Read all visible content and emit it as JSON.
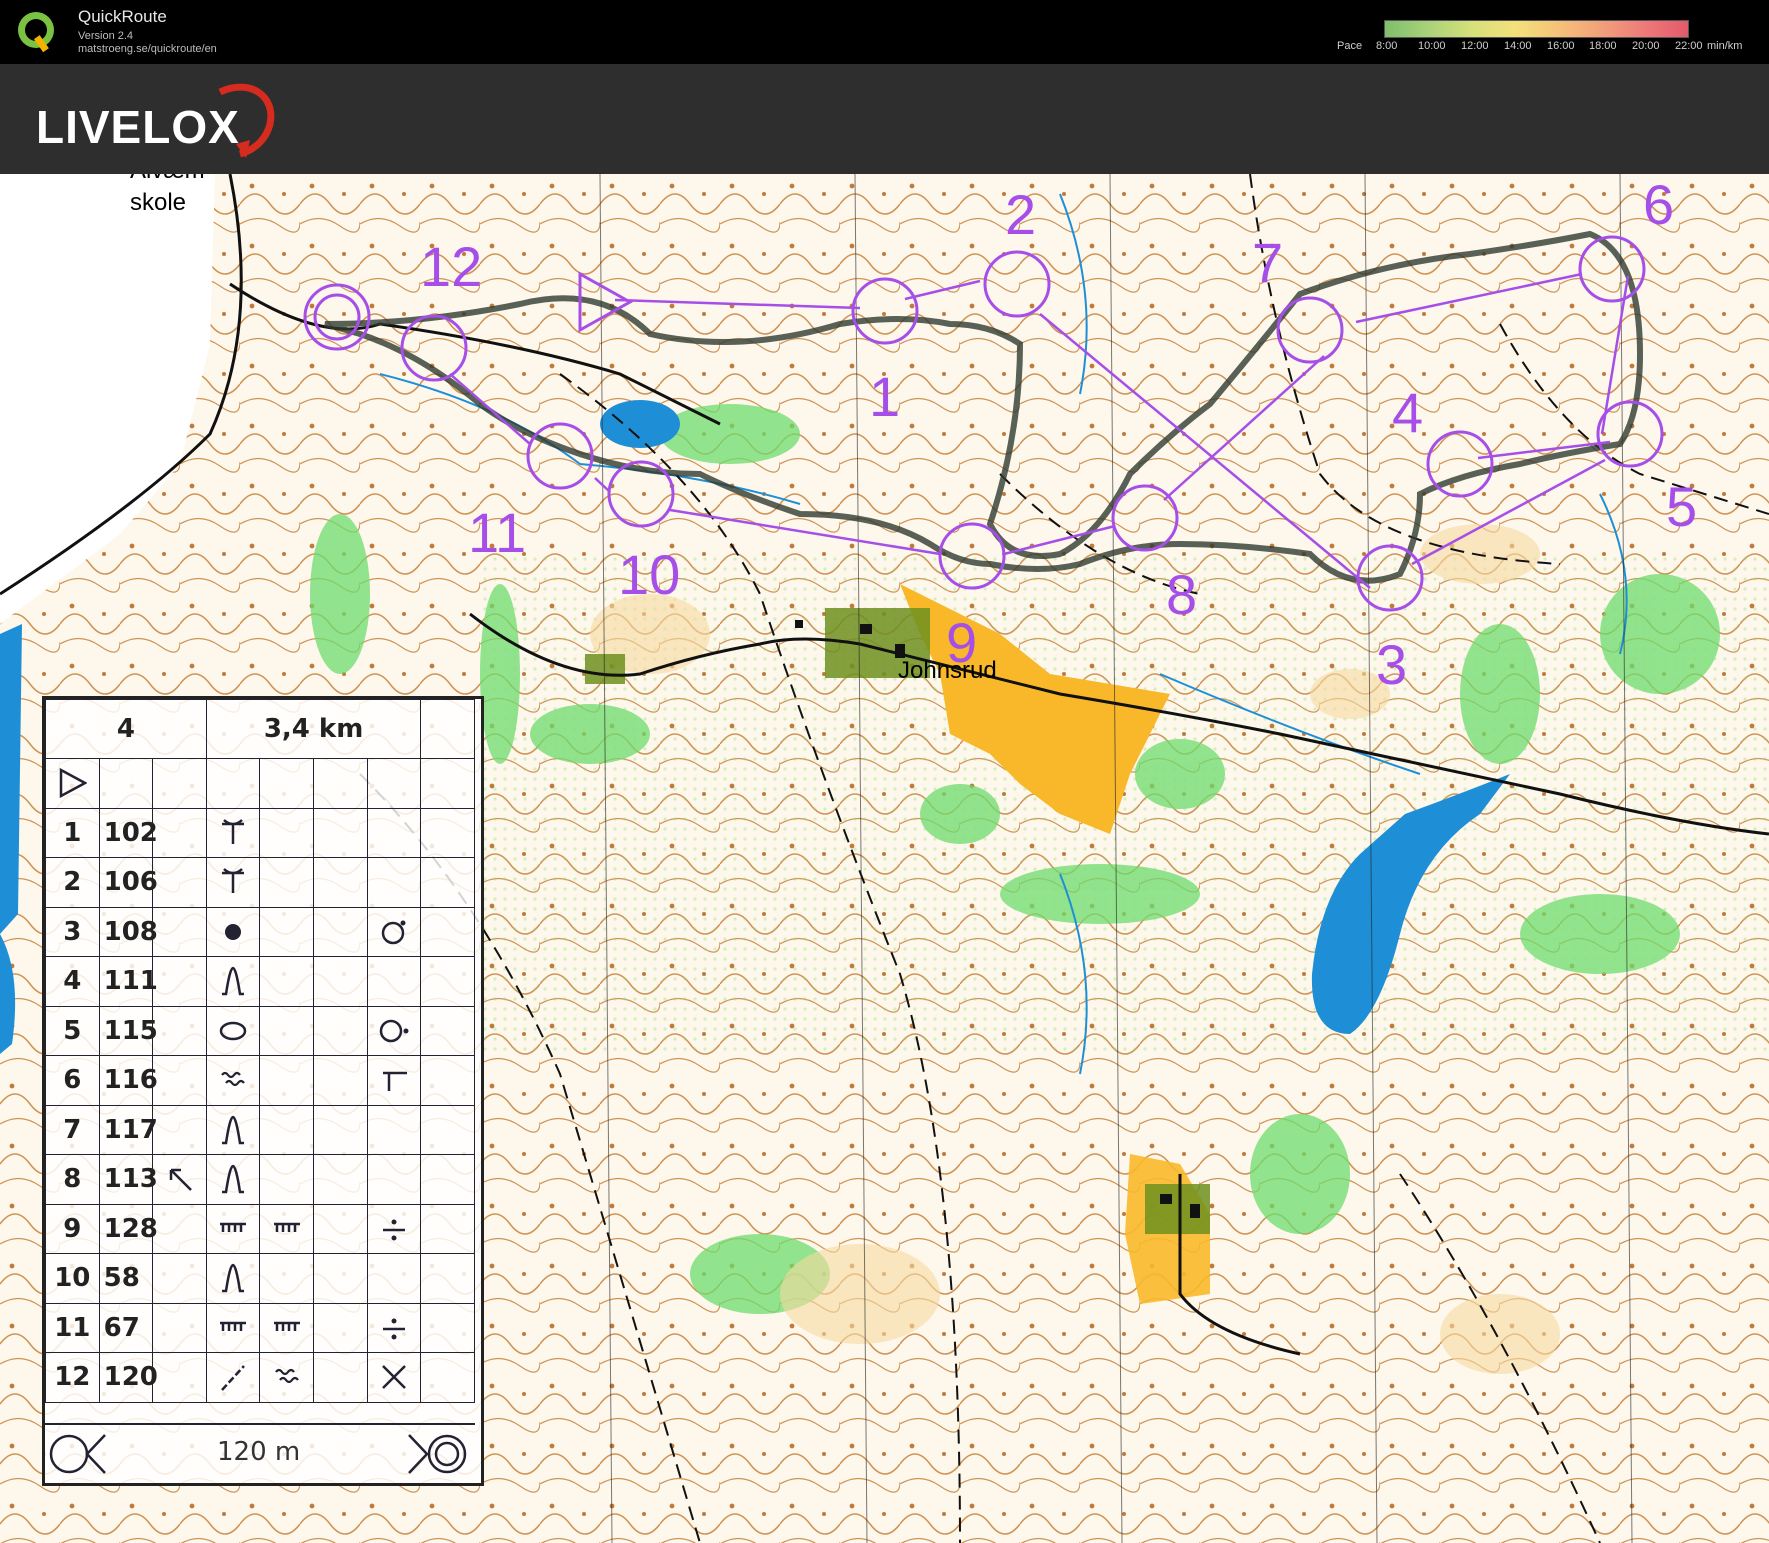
{
  "app": {
    "name": "QuickRoute",
    "version": "Version 2.4",
    "url": "matstroeng.se/quickroute/en"
  },
  "pace_legend": {
    "label": "Pace",
    "ticks": [
      "8:00",
      "10:00",
      "12:00",
      "14:00",
      "16:00",
      "18:00",
      "20:00",
      "22:00"
    ],
    "unit": "min/km"
  },
  "brand": {
    "logo_text": "LIVELOX",
    "accent": "#d62b1f"
  },
  "colors": {
    "course": "#a64ee8",
    "route": "#3a4a3a",
    "water": "#1e8fd6",
    "open_land": "#f8b82a",
    "vegetation": "#5ed35e",
    "contours": "#b5651d"
  },
  "map": {
    "place_names": [
      "Alvæm",
      "skole",
      "Johnsrud"
    ],
    "controls": [
      "1",
      "2",
      "3",
      "4",
      "5",
      "6",
      "7",
      "8",
      "9",
      "10",
      "11",
      "12"
    ]
  },
  "control_descriptions": {
    "header": {
      "left": "4",
      "distance": "3,4 km"
    },
    "rows": [
      {
        "num": "1",
        "code": "102",
        "feature": "trail-junction-icon",
        "extra": ""
      },
      {
        "num": "2",
        "code": "106",
        "feature": "trail-junction-icon",
        "extra": ""
      },
      {
        "num": "3",
        "code": "108",
        "feature": "boulder-icon",
        "extra": "foot-icon"
      },
      {
        "num": "4",
        "code": "111",
        "feature": "knoll-icon",
        "extra": ""
      },
      {
        "num": "5",
        "code": "115",
        "feature": "depression-icon",
        "extra": "foot-side-icon"
      },
      {
        "num": "6",
        "code": "116",
        "feature": "marsh-icon",
        "extra": "end-icon"
      },
      {
        "num": "7",
        "code": "117",
        "feature": "knoll-icon",
        "extra": ""
      },
      {
        "num": "8",
        "code": "113",
        "feature": "knoll-icon",
        "extra": "",
        "direction": "northwest-arrow-icon"
      },
      {
        "num": "9",
        "code": "128",
        "feature": "cliff-icon",
        "extra": "between-icon",
        "feature2": "cliff-icon"
      },
      {
        "num": "10",
        "code": "58",
        "feature": "knoll-icon",
        "extra": ""
      },
      {
        "num": "11",
        "code": "67",
        "feature": "cliff-icon",
        "extra": "between-icon",
        "feature2": "cliff-icon"
      },
      {
        "num": "12",
        "code": "120",
        "feature": "path-icon",
        "extra": "cross-icon",
        "feature2": "marsh-icon"
      }
    ],
    "footer": {
      "distance": "120 m"
    }
  }
}
